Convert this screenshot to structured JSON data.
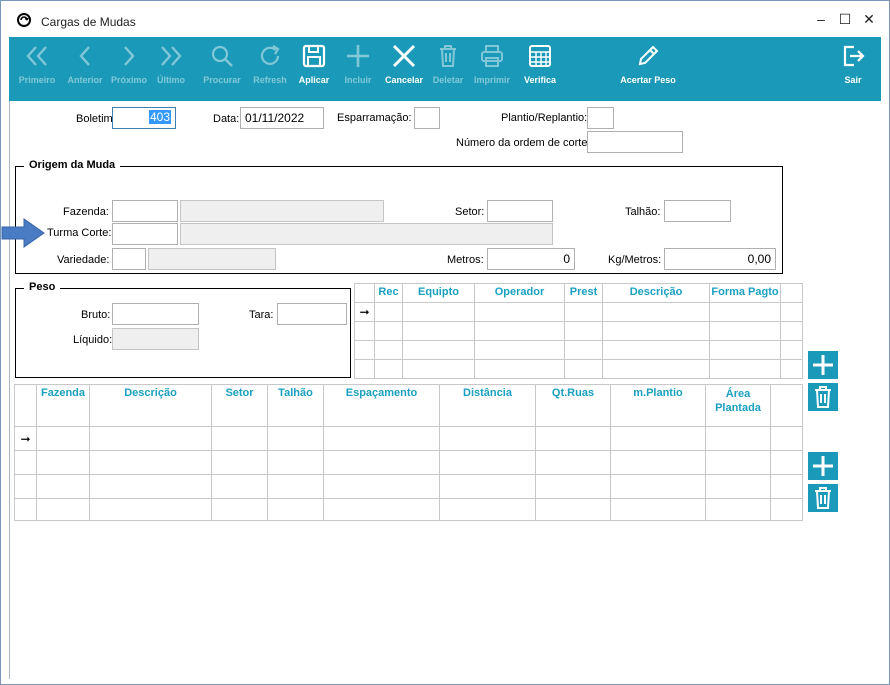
{
  "window": {
    "title": "Cargas de Mudas",
    "controls": {
      "minimize": "–",
      "maximize": "☐",
      "close": "✕"
    }
  },
  "toolbar": {
    "color": "#1a9ab8",
    "buttons": [
      {
        "label": "Primeiro",
        "icon": "double-chevron-left-icon",
        "enabled": false
      },
      {
        "label": "Anterior",
        "icon": "chevron-left-icon",
        "enabled": false
      },
      {
        "label": "Próximo",
        "icon": "chevron-right-icon",
        "enabled": false
      },
      {
        "label": "Último",
        "icon": "double-chevron-right-icon",
        "enabled": false
      },
      {
        "label": "Procurar",
        "icon": "search-icon",
        "enabled": false
      },
      {
        "label": "Refresh",
        "icon": "refresh-icon",
        "enabled": false
      },
      {
        "label": "Aplicar",
        "icon": "save-icon",
        "enabled": true
      },
      {
        "label": "Incluir",
        "icon": "plus-icon",
        "enabled": false
      },
      {
        "label": "Cancelar",
        "icon": "close-icon",
        "enabled": true
      },
      {
        "label": "Deletar",
        "icon": "trash-icon",
        "enabled": false
      },
      {
        "label": "Imprimir",
        "icon": "printer-icon",
        "enabled": false
      },
      {
        "label": "Verifica",
        "icon": "calculator-icon",
        "enabled": true
      },
      {
        "label": "Acertar Peso",
        "icon": "pencil-icon",
        "enabled": true
      },
      {
        "label": "Sair",
        "icon": "exit-icon",
        "enabled": true
      }
    ]
  },
  "header": {
    "boletim_label": "Boletim",
    "boletim_value": "403",
    "data_label": "Data:",
    "data_value": "01/11/2022",
    "esparramacao_label": "Esparramação:",
    "esparramacao_value": "",
    "plantio_label": "Plantio/Replantio:",
    "plantio_value": "",
    "ordem_label": "Número da ordem de corte:",
    "ordem_value": ""
  },
  "origem": {
    "title": "Origem da Muda",
    "fazenda_label": "Fazenda:",
    "turma_label": "Turma Corte:",
    "variedade_label": "Variedade:",
    "setor_label": "Setor:",
    "metros_label": "Metros:",
    "metros_value": "0",
    "talhao_label": "Talhão:",
    "kgmetros_label": "Kg/Metros:",
    "kgmetros_value": "0,00"
  },
  "peso": {
    "title": "Peso",
    "bruto_label": "Bruto:",
    "tara_label": "Tara:",
    "liquido_label": "Líquido:"
  },
  "grid_equipos": {
    "columns": [
      "Rec",
      "Equipto",
      "Operador",
      "Prest",
      "Descrição",
      "Forma Pagto"
    ],
    "current_row_marker": "➞"
  },
  "grid_plantio": {
    "columns": [
      "Fazenda",
      "Descrição",
      "Setor",
      "Talhão",
      "Espaçamento",
      "Distância",
      "Qt.Ruas",
      "m.Plantio",
      "Área Plantada"
    ],
    "current_row_marker": "➞"
  }
}
